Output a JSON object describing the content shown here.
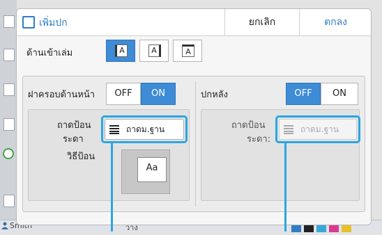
{
  "dialog": {
    "title": "เพิ่มปก",
    "cancel_label": "ยกเลิก",
    "ok_label": "ตกลง"
  },
  "binding": {
    "label": "ด้านเข้าเล่ม",
    "options": [
      {
        "glyph": "A",
        "selected": true
      },
      {
        "glyph": "A",
        "selected": false
      },
      {
        "glyph": "A",
        "selected": false
      }
    ]
  },
  "front_cover": {
    "label": "ฝาครอบด้านหน้า",
    "off_label": "OFF",
    "on_label": "ON",
    "state": "ON",
    "tray_label": "ถาดป้อน",
    "tray_label_2": "ระดา",
    "tray_value": "ถาดม.ฐาน",
    "feed_label": "วิธีป้อน",
    "feed_preview": "Aa"
  },
  "back_cover": {
    "label": "ปกหลัง",
    "off_label": "OFF",
    "on_label": "ON",
    "state": "OFF",
    "tray_label": "ถาดป้อน",
    "tray_label_2": "ระดา:",
    "tray_value": "ถาดม.ฐาน"
  },
  "status_bar": {
    "user": "Smith",
    "middle": "ว่าง"
  },
  "colors": {
    "accent": "#3e8bd6",
    "highlight": "#2aa7e0",
    "title": "#2f7dc4"
  }
}
